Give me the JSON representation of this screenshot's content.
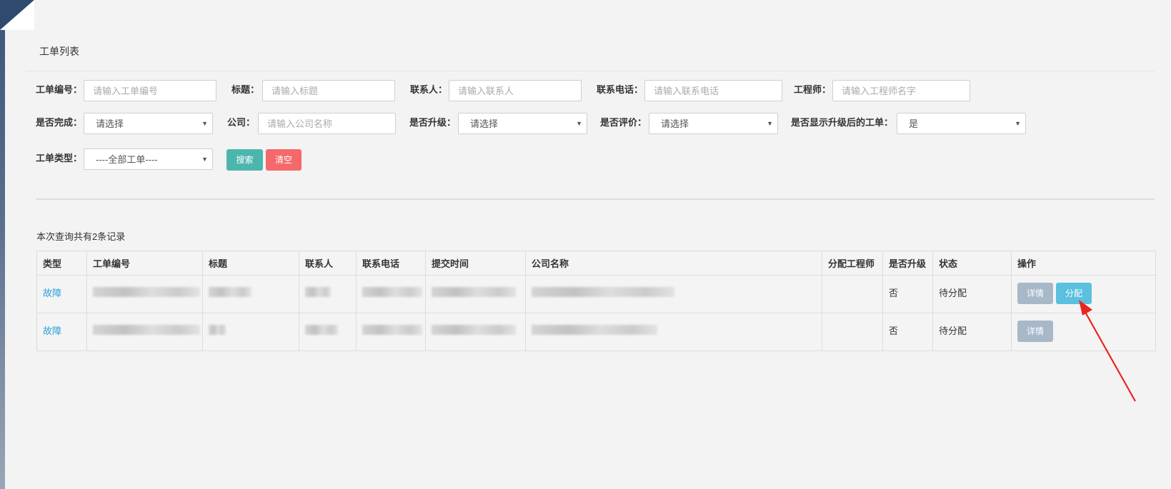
{
  "panel": {
    "title": "工单列表"
  },
  "filters": {
    "order_no": {
      "label": "工单编号：",
      "placeholder": "请输入工单编号"
    },
    "title": {
      "label": "标题：",
      "placeholder": "请输入标题"
    },
    "contact": {
      "label": "联系人：",
      "placeholder": "请输入联系人"
    },
    "phone": {
      "label": "联系电话：",
      "placeholder": "请输入联系电话"
    },
    "engineer": {
      "label": "工程师：",
      "placeholder": "请输入工程师名字"
    },
    "completed": {
      "label": "是否完成：",
      "value": "请选择"
    },
    "company": {
      "label": "公司：",
      "placeholder": "请输入公司名称"
    },
    "upgraded": {
      "label": "是否升级：",
      "value": "请选择"
    },
    "evaluated": {
      "label": "是否评价：",
      "value": "请选择"
    },
    "show_upgraded": {
      "label": "是否显示升级后的工单：",
      "value": "是"
    },
    "order_type": {
      "label": "工单类型：",
      "value": "----全部工单----"
    },
    "caret": "▼"
  },
  "buttons": {
    "search": "搜索",
    "clear": "清空"
  },
  "result_count": "本次查询共有2条记录",
  "table": {
    "headers": [
      "类型",
      "工单编号",
      "标题",
      "联系人",
      "联系电话",
      "提交时间",
      "公司名称",
      "分配工程师",
      "是否升级",
      "状态",
      "操作"
    ],
    "rows": [
      {
        "type": "故障",
        "upgraded": "否",
        "status": "待分配",
        "actions": [
          "详情",
          "分配"
        ]
      },
      {
        "type": "故障",
        "upgraded": "否",
        "status": "待分配",
        "actions": [
          "详情"
        ]
      }
    ]
  },
  "colors": {
    "accent_link": "#2b9fd9",
    "search": "#4cb6ad",
    "clear": "#f5696c",
    "assign": "#5bc0de",
    "detail": "#a7b8c9",
    "arrow": "#e8261f"
  }
}
